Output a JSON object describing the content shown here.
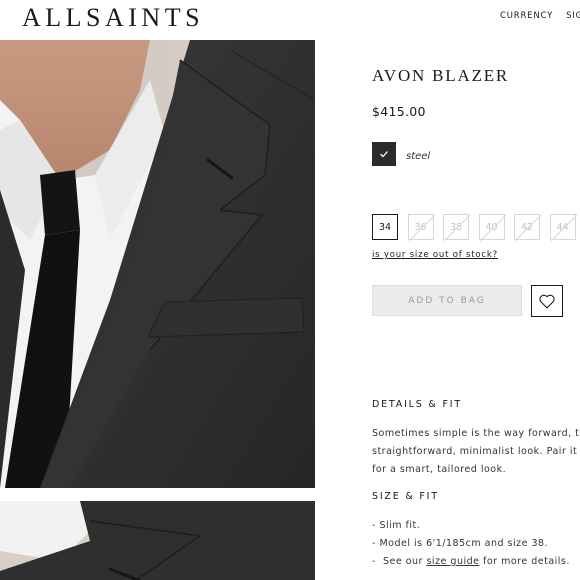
{
  "header": {
    "logo": "ALLSAINTS",
    "nav": [
      "CURRENCY",
      "SIGN"
    ]
  },
  "product": {
    "title": "AVON BLAZER",
    "price": "$415.00",
    "colour": {
      "name": "steel",
      "hex": "#2b2b2b"
    },
    "sizes": [
      {
        "label": "34",
        "in_stock": true
      },
      {
        "label": "36",
        "in_stock": false
      },
      {
        "label": "38",
        "in_stock": false
      },
      {
        "label": "40",
        "in_stock": false
      },
      {
        "label": "42",
        "in_stock": false
      },
      {
        "label": "44",
        "in_stock": false
      }
    ],
    "size_stock_link": "is your size out of stock?",
    "add_to_bag": "ADD TO BAG"
  },
  "details": {
    "heading": "DETAILS & FIT",
    "lines": [
      "Sometimes simple is the way forward, the",
      "straightforward, minimalist look. Pair it w",
      "for a smart, tailored look."
    ]
  },
  "size_fit": {
    "heading": "SIZE & FIT",
    "item1": "- Slim fit.",
    "item2": "- Model is 6'1/185cm and size 38.",
    "item3_prefix": "-  See our ",
    "item3_link": "size guide",
    "item3_suffix": " for more details."
  },
  "colors": {
    "accent": "#1a1a1a",
    "disabled_button": "#ebebeb",
    "jacket": "#2e2e2e"
  }
}
